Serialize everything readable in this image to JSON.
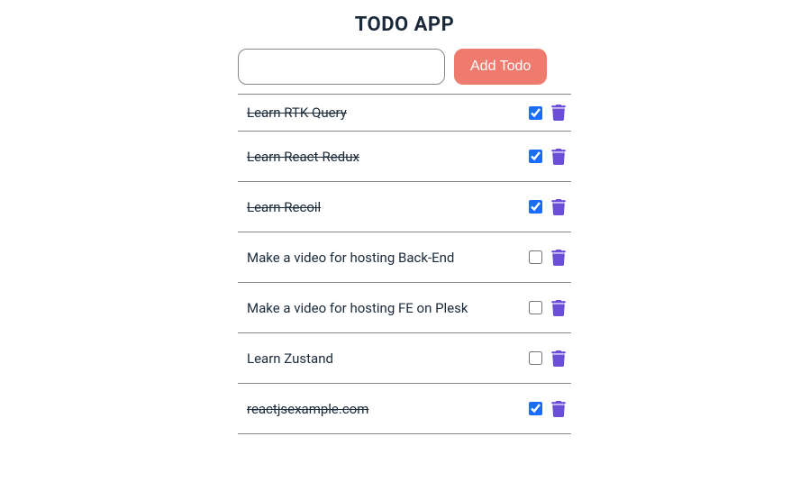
{
  "header": {
    "title": "TODO APP"
  },
  "form": {
    "input_value": "",
    "add_button_label": "Add Todo"
  },
  "todos": [
    {
      "text": "Learn RTK Query",
      "completed": true
    },
    {
      "text": "Learn React-Redux",
      "completed": true
    },
    {
      "text": "Learn Recoil",
      "completed": true
    },
    {
      "text": "Make a video for hosting Back-End",
      "completed": false
    },
    {
      "text": "Make a video for hosting FE on Plesk",
      "completed": false
    },
    {
      "text": "Learn Zustand",
      "completed": false
    },
    {
      "text": "reactjsexample.com",
      "completed": true
    }
  ]
}
